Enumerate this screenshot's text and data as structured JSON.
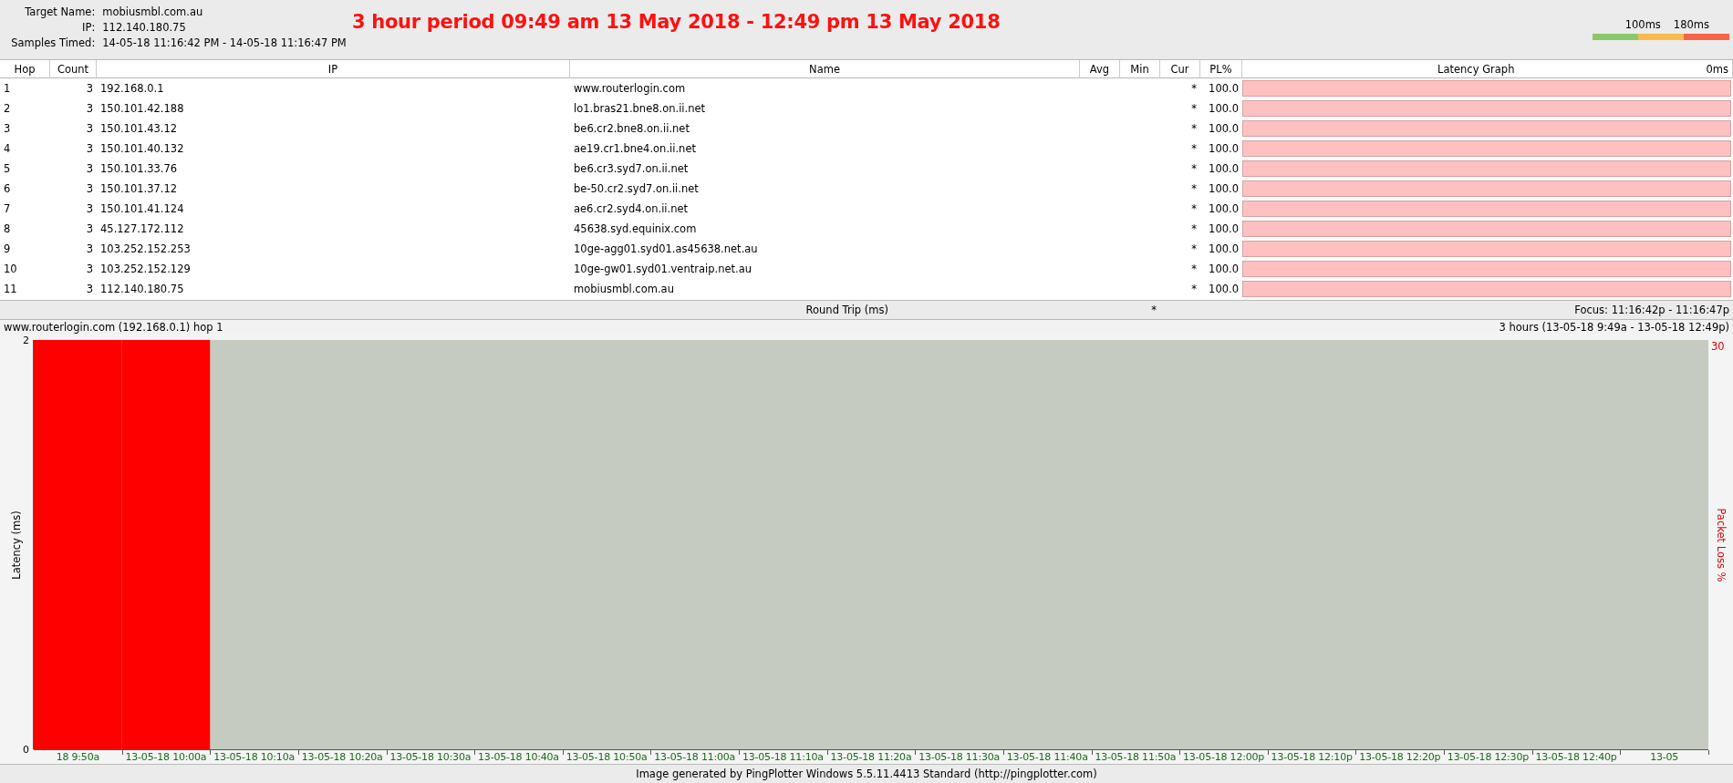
{
  "target": {
    "name_label": "Target Name:",
    "name": "mobiusmbl.com.au",
    "ip_label": "IP:",
    "ip": "112.140.180.75",
    "samples_label": "Samples Timed:",
    "samples": "14-05-18 11:16:42 PM - 14-05-18 11:16:47 PM"
  },
  "title": "3 hour period 09:49 am 13 May 2018 - 12:49 pm 13 May 2018",
  "legend": [
    "100ms",
    "180ms"
  ],
  "table": {
    "columns": [
      "Hop",
      "Count",
      "IP",
      "Name",
      "Avg",
      "Min",
      "Cur",
      "PL%",
      "Latency Graph"
    ],
    "graph_scale": "0ms",
    "rows": [
      {
        "hop": "1",
        "count": "3",
        "ip": "192.168.0.1",
        "name": "www.routerlogin.com",
        "cur": "*",
        "pl": "100.0"
      },
      {
        "hop": "2",
        "count": "3",
        "ip": "150.101.42.188",
        "name": "lo1.bras21.bne8.on.ii.net",
        "cur": "*",
        "pl": "100.0"
      },
      {
        "hop": "3",
        "count": "3",
        "ip": "150.101.43.12",
        "name": "be6.cr2.bne8.on.ii.net",
        "cur": "*",
        "pl": "100.0"
      },
      {
        "hop": "4",
        "count": "3",
        "ip": "150.101.40.132",
        "name": "ae19.cr1.bne4.on.ii.net",
        "cur": "*",
        "pl": "100.0"
      },
      {
        "hop": "5",
        "count": "3",
        "ip": "150.101.33.76",
        "name": "be6.cr3.syd7.on.ii.net",
        "cur": "*",
        "pl": "100.0"
      },
      {
        "hop": "6",
        "count": "3",
        "ip": "150.101.37.12",
        "name": "be-50.cr2.syd7.on.ii.net",
        "cur": "*",
        "pl": "100.0"
      },
      {
        "hop": "7",
        "count": "3",
        "ip": "150.101.41.124",
        "name": "ae6.cr2.syd4.on.ii.net",
        "cur": "*",
        "pl": "100.0"
      },
      {
        "hop": "8",
        "count": "3",
        "ip": "45.127.172.112",
        "name": "45638.syd.equinix.com",
        "cur": "*",
        "pl": "100.0"
      },
      {
        "hop": "9",
        "count": "3",
        "ip": "103.252.152.253",
        "name": "10ge-agg01.syd01.as45638.net.au",
        "cur": "*",
        "pl": "100.0"
      },
      {
        "hop": "10",
        "count": "3",
        "ip": "103.252.152.129",
        "name": "10ge-gw01.syd01.ventraip.net.au",
        "cur": "*",
        "pl": "100.0"
      },
      {
        "hop": "11",
        "count": "3",
        "ip": "112.140.180.75",
        "name": "mobiusmbl.com.au",
        "cur": "*",
        "pl": "100.0"
      }
    ],
    "round_trip": {
      "label": "Round Trip (ms)",
      "cur": "*",
      "focus": "Focus: 11:16:42p - 11:16:47p"
    }
  },
  "chart": {
    "host": "www.routerlogin.com (192.168.0.1) hop 1",
    "range": "3 hours (13-05-18 9:49a - 13-05-18 12:49p)",
    "right_axis_max": "30",
    "chart_data": {
      "type": "bar",
      "ylabel": "Latency (ms)",
      "ylim": [
        0,
        2
      ],
      "yticks": [
        0,
        2
      ],
      "categories": [
        "18 9:50a",
        "13-05-18 10:00a",
        "13-05-18 10:10a",
        "13-05-18 10:20a",
        "13-05-18 10:30a",
        "13-05-18 10:40a",
        "13-05-18 10:50a",
        "13-05-18 11:00a",
        "13-05-18 11:10a",
        "13-05-18 11:20a",
        "13-05-18 11:30a",
        "13-05-18 11:40a",
        "13-05-18 11:50a",
        "13-05-18 12:00p",
        "13-05-18 12:10p",
        "13-05-18 12:20p",
        "13-05-18 12:30p",
        "13-05-18 12:40p",
        "13-05"
      ],
      "series": [
        {
          "name": "Packet Loss %",
          "color": "#ff0000",
          "values": [
            2,
            2,
            null,
            null,
            null,
            null,
            null,
            null,
            null,
            null,
            null,
            null,
            null,
            null,
            null,
            null,
            null,
            null,
            null
          ]
        }
      ]
    }
  },
  "footer": "Image generated by PingPlotter Windows 5.5.11.4413 Standard (http://pingplotter.com)"
}
